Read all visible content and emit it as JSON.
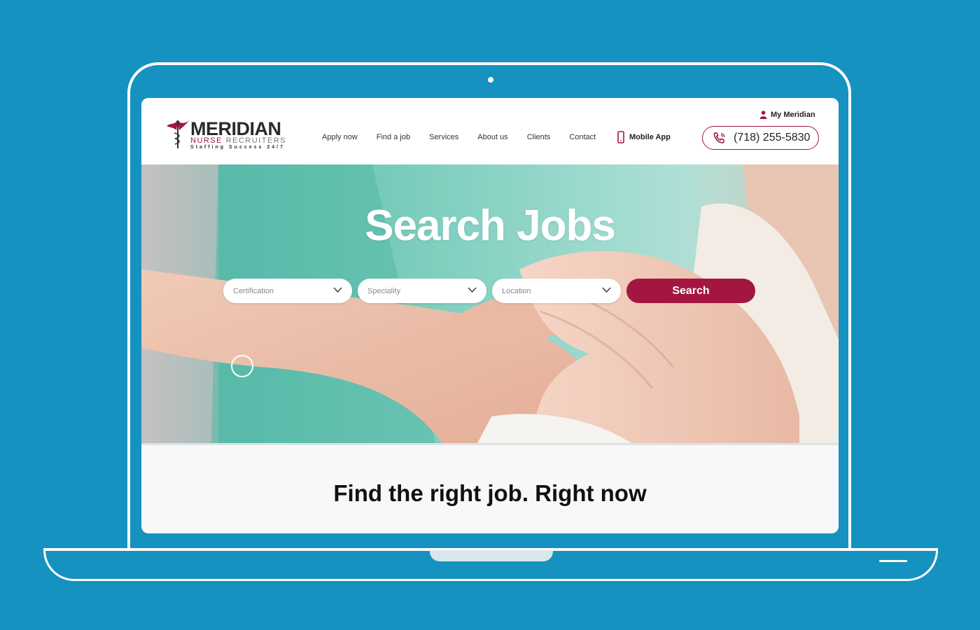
{
  "brand": {
    "name": "MERIDIAN",
    "sub_red": "NURSE",
    "sub_gray": "RECRUITERS",
    "tagline": "Staffing Success 24/7"
  },
  "nav": {
    "items": [
      {
        "label": "Apply now"
      },
      {
        "label": "Find a job"
      },
      {
        "label": "Services"
      },
      {
        "label": "About us"
      },
      {
        "label": "Clients"
      },
      {
        "label": "Contact"
      }
    ],
    "mobile_app": "Mobile App",
    "my_meridian": "My Meridian",
    "phone": "(718) 255-5830"
  },
  "hero": {
    "title": "Search Jobs",
    "filters": {
      "certification": "Certification",
      "speciality": "Speciality",
      "location": "Location"
    },
    "search_label": "Search"
  },
  "section": {
    "tagline": "Find the right job. Right now"
  },
  "colors": {
    "accent": "#a3163f",
    "background": "#1592c0"
  }
}
